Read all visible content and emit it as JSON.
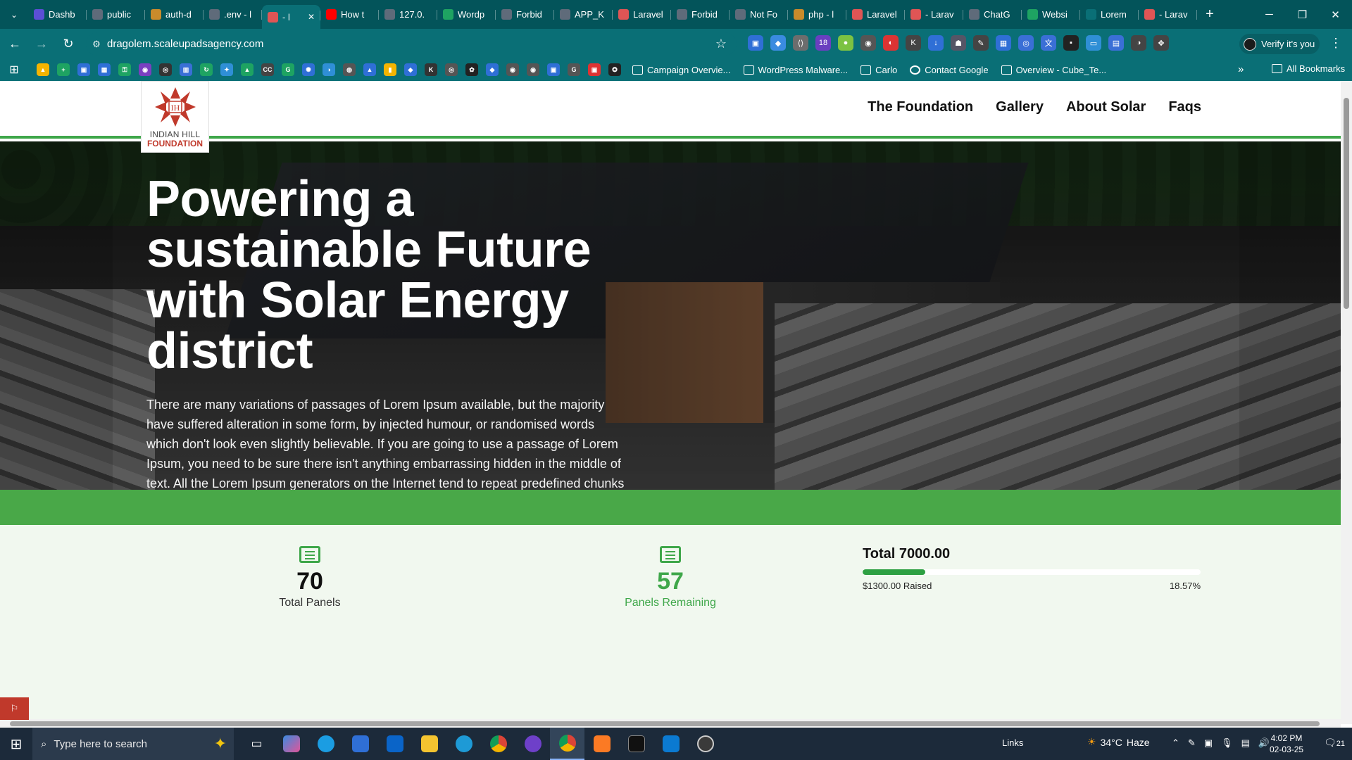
{
  "browser": {
    "tabs": [
      {
        "title": "Dashb",
        "fav_color": "#5b4fd6"
      },
      {
        "title": "public",
        "fav_color": "#5f6b7a"
      },
      {
        "title": "auth-d",
        "fav_color": "#c98b2b"
      },
      {
        "title": ".env - l",
        "fav_color": "#5f6b7a"
      },
      {
        "title": "- l",
        "fav_color": "#e05555",
        "active": true
      },
      {
        "title": "How t",
        "fav_color": "#ff0000"
      },
      {
        "title": "127.0.",
        "fav_color": "#5f6b7a"
      },
      {
        "title": "Wordp",
        "fav_color": "#1ea362"
      },
      {
        "title": "Forbid",
        "fav_color": "#5f6b7a"
      },
      {
        "title": "APP_K",
        "fav_color": "#5f6b7a"
      },
      {
        "title": "Laravel",
        "fav_color": "#e05555"
      },
      {
        "title": "Forbid",
        "fav_color": "#5f6b7a"
      },
      {
        "title": "Not Fo",
        "fav_color": "#5f6b7a"
      },
      {
        "title": "php - l",
        "fav_color": "#c98b2b"
      },
      {
        "title": "Laravel",
        "fav_color": "#e05555"
      },
      {
        "title": "- Larav",
        "fav_color": "#e05555"
      },
      {
        "title": "ChatG",
        "fav_color": "#5f6b7a"
      },
      {
        "title": "Websi",
        "fav_color": "#1ea362"
      },
      {
        "title": "Lorem",
        "fav_color": "#0a6f76"
      },
      {
        "title": "- Larav",
        "fav_color": "#e05555"
      }
    ],
    "new_tab": "+",
    "url": "dragolem.scaleupadsagency.com",
    "profile_label": "Verify it's you",
    "bookmarks": [
      {
        "label": "Campaign Overvie...",
        "icon": "folder"
      },
      {
        "label": "WordPress Malware...",
        "icon": "wordpress"
      },
      {
        "label": "Carlo",
        "icon": "folder"
      },
      {
        "label": "Contact Google",
        "icon": "google"
      },
      {
        "label": "Overview - Cube_Te...",
        "icon": "drive"
      }
    ],
    "all_bookmarks": "All Bookmarks"
  },
  "site": {
    "logo": {
      "line1": "INDIAN HILL",
      "line2": "FOUNDATION"
    },
    "nav": [
      {
        "label": "The Foundation"
      },
      {
        "label": "Gallery"
      },
      {
        "label": "About Solar"
      },
      {
        "label": "Faqs"
      }
    ],
    "hero": {
      "title": "Powering a sustainable Future with Solar Energy district",
      "text": "There are many variations of passages of Lorem Ipsum available, but the majority have suffered alteration in some form, by injected humour, or randomised words which don't look even slightly believable. If you are going to use a passage of Lorem Ipsum, you need to be sure there isn't anything embarrassing hidden in the middle of text. All the Lorem Ipsum generators on the Internet tend to repeat predefined chunks as necessary, making this the first true generator on the Internet."
    },
    "stats": {
      "total_panels": {
        "value": "70",
        "label": "Total Panels"
      },
      "panels_remaining": {
        "value": "57",
        "label": "Panels Remaining"
      }
    },
    "funding": {
      "total": "Total 7000.00",
      "raised": "$1300.00 Raised",
      "percent": "18.57%",
      "progress_fraction": 0.1857
    },
    "accent_color": "#3fa74a"
  },
  "taskbar": {
    "search_placeholder": "Type here to search",
    "links": "Links",
    "temperature": "34°C",
    "weather": "Haze",
    "time": "4:02 PM",
    "date": "02-03-25",
    "notifications": "21"
  }
}
